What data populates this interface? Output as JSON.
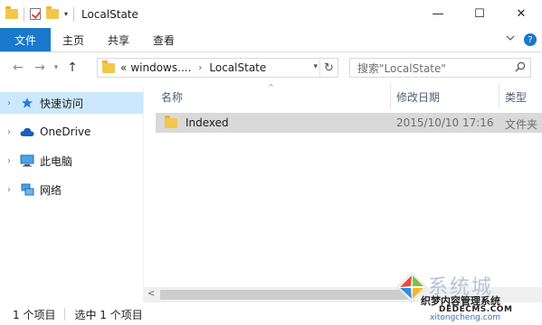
{
  "window": {
    "title": "LocalState",
    "minimize": "—",
    "maximize": "☐",
    "close": "✕"
  },
  "ribbon": {
    "tabs": [
      "文件",
      "主页",
      "共享",
      "查看"
    ],
    "collapse_icon": "chevron-down",
    "help_icon": "?"
  },
  "address": {
    "prefix": "«",
    "crumbs": [
      "windows....",
      "LocalState"
    ],
    "separator": "›"
  },
  "search": {
    "placeholder": "搜索\"LocalState\""
  },
  "nav_pane": {
    "items": [
      {
        "label": "快速访问",
        "icon": "star-icon",
        "selected": true
      },
      {
        "label": "OneDrive",
        "icon": "cloud-icon",
        "selected": false
      },
      {
        "label": "此电脑",
        "icon": "computer-icon",
        "selected": false
      },
      {
        "label": "网络",
        "icon": "network-icon",
        "selected": false
      }
    ]
  },
  "columns": {
    "name": "名称",
    "date": "修改日期",
    "type": "类型"
  },
  "files": [
    {
      "name": "Indexed",
      "date": "2015/10/10 17:16",
      "type": "文件夹"
    }
  ],
  "status": {
    "count": "1 个项目",
    "selected": "选中 1 个项目"
  },
  "watermark": {
    "brand": "系统城",
    "line1": "织梦内容管理系统",
    "line2": "DEDECMS.COM",
    "line3": "xitongcheng.com"
  },
  "colors": {
    "accent": "#1979ca",
    "selection": "#cce8ff",
    "row_highlight": "#d9d9d9",
    "folder": "#f3c64c"
  }
}
